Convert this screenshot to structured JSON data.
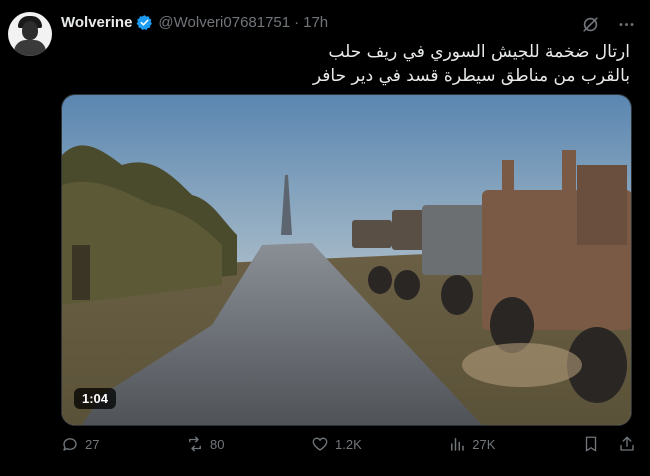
{
  "author": {
    "name": "Wolverine",
    "handle": "@Wolveri07681751",
    "separator": "·",
    "time": "17h",
    "verified_color": "#1d9bf0"
  },
  "tweet": {
    "text_line1": "ارتال ضخمة للجيش السوري في ريف حلب",
    "text_line2": "بالقرب من مناطق سيطرة قسد في دير حافر"
  },
  "media": {
    "duration": "1:04"
  },
  "actions": {
    "replies": "27",
    "reposts": "80",
    "likes": "1.2K",
    "views": "27K"
  }
}
